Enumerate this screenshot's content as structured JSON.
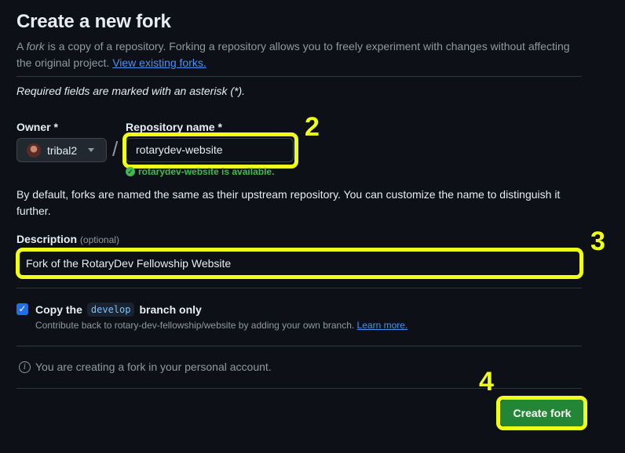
{
  "page": {
    "title": "Create a new fork",
    "intro_prefix": "A ",
    "intro_em": "fork",
    "intro_rest": " is a copy of a repository. Forking a repository allows you to freely experiment with changes without affecting the original project. ",
    "view_forks_link": "View existing forks.",
    "required_note": "Required fields are marked with an asterisk (*)."
  },
  "owner": {
    "label": "Owner *",
    "value": "tribal2"
  },
  "slash": "/",
  "repo": {
    "label": "Repository name *",
    "value": "rotarydev-website",
    "availability": "rotarydev-website is available."
  },
  "help_text": "By default, forks are named the same as their upstream repository. You can customize the name to distinguish it further.",
  "description": {
    "label": "Description",
    "optional": "(optional)",
    "value": "Fork of the RotaryDev Fellowship Website"
  },
  "copy_branch": {
    "checked": true,
    "prefix": "Copy the",
    "branch": "develop",
    "suffix": "branch only",
    "note": "Contribute back to rotary-dev-fellowship/website by adding your own branch. ",
    "learn_more": "Learn more."
  },
  "info_text": "You are creating a fork in your personal account.",
  "create_button": "Create fork",
  "annotations": [
    "2",
    "3",
    "4"
  ],
  "colors": {
    "background": "#0d1117",
    "highlight": "#f0ff1a",
    "primary_button": "#238636",
    "link": "#4493f8",
    "success": "#3fb950"
  }
}
